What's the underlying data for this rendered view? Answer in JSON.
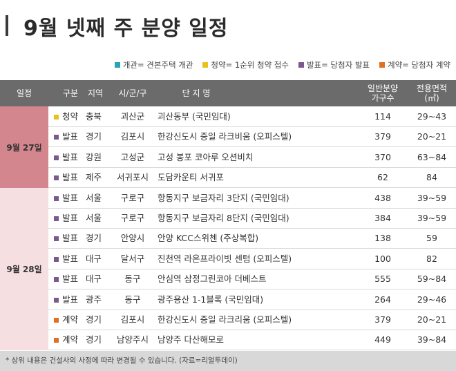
{
  "title": "9월 넷째 주 분양 일정",
  "legend": [
    {
      "label": "개관= 견본주택 개관",
      "color": "#29a3b8"
    },
    {
      "label": "청약= 1순위 청약 접수",
      "color": "#e8c21c"
    },
    {
      "label": "발표= 당첨자 발표",
      "color": "#7a5a8c"
    },
    {
      "label": "계약= 당첨자 계약",
      "color": "#e07020"
    }
  ],
  "headers": {
    "date": "일정",
    "type": "구분",
    "region": "지역",
    "city": "시/군/구",
    "name": "단 지 명",
    "units_line1": "일반분양",
    "units_line2": "가구수",
    "area_line1": "전용면적",
    "area_line2": "(㎡)"
  },
  "groups": [
    {
      "date": "9월 27일"
    },
    {
      "date": "9월 28일"
    }
  ],
  "rows": [
    {
      "type": "청약",
      "region": "충북",
      "city": "괴산군",
      "name": "괴산동부 (국민임대)",
      "units": "114",
      "area": "29~43",
      "color": "#e8c21c"
    },
    {
      "type": "발표",
      "region": "경기",
      "city": "김포시",
      "name": "한강신도시 중일 라크비움 (오피스텔)",
      "units": "379",
      "area": "20~21",
      "color": "#7a5a8c"
    },
    {
      "type": "발표",
      "region": "강원",
      "city": "고성군",
      "name": "고성 봉포 코아루 오션비치",
      "units": "370",
      "area": "63~84",
      "color": "#7a5a8c"
    },
    {
      "type": "발표",
      "region": "제주",
      "city": "서귀포시",
      "name": "도담카운티 서귀포",
      "units": "62",
      "area": "84",
      "color": "#7a5a8c"
    },
    {
      "type": "발표",
      "region": "서울",
      "city": "구로구",
      "name": "항동지구 보금자리 3단지 (국민임대)",
      "units": "438",
      "area": "39~59",
      "color": "#7a5a8c"
    },
    {
      "type": "발표",
      "region": "서울",
      "city": "구로구",
      "name": "항동지구 보금자리 8단지 (국민임대)",
      "units": "384",
      "area": "39~59",
      "color": "#7a5a8c"
    },
    {
      "type": "발표",
      "region": "경기",
      "city": "안양시",
      "name": "안양 KCC스위첸 (주상복합)",
      "units": "138",
      "area": "59",
      "color": "#7a5a8c"
    },
    {
      "type": "발표",
      "region": "대구",
      "city": "달서구",
      "name": "진천역 라온프라이빗 센텀 (오피스텔)",
      "units": "100",
      "area": "82",
      "color": "#7a5a8c"
    },
    {
      "type": "발표",
      "region": "대구",
      "city": "동구",
      "name": "안심역 삼정그린코아 더베스트",
      "units": "555",
      "area": "59~84",
      "color": "#7a5a8c"
    },
    {
      "type": "발표",
      "region": "광주",
      "city": "동구",
      "name": "광주용산 1-1블록 (국민임대)",
      "units": "264",
      "area": "29~46",
      "color": "#7a5a8c"
    },
    {
      "type": "계약",
      "region": "경기",
      "city": "김포시",
      "name": "한강신도시 중일 라크리움 (오피스텔)",
      "units": "379",
      "area": "20~21",
      "color": "#e07020"
    },
    {
      "type": "계약",
      "region": "경기",
      "city": "남양주시",
      "name": "남양주 다산해모로",
      "units": "449",
      "area": "39~84",
      "color": "#e07020"
    }
  ],
  "footer": "* 상위 내용은 건설사의 사정에 따라 변경될 수 있습니다. (자료=리얼투데이)"
}
